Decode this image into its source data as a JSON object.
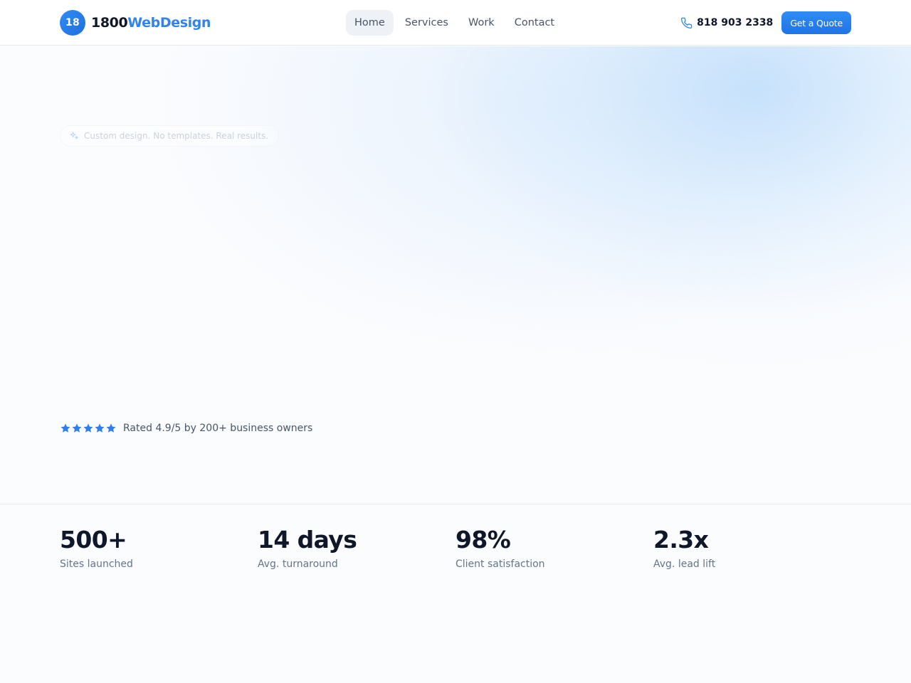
{
  "header": {
    "logo_badge": "18",
    "logo_text_a": "1800",
    "logo_text_b": "WebDesign",
    "nav": [
      {
        "label": "Home",
        "active": true
      },
      {
        "label": "Services",
        "active": false
      },
      {
        "label": "Work",
        "active": false
      },
      {
        "label": "Contact",
        "active": false
      }
    ],
    "phone": "818 903 2338",
    "phone_icon": "phone-icon",
    "cta_label": "Get a Quote"
  },
  "hero": {
    "pill_icon": "sparkle-icon",
    "pill_text": "Custom design. No templates. Real results.",
    "rating_stars": 5,
    "rating_text": "Rated 4.9/5 by 200+ business owners"
  },
  "stats": [
    {
      "value": "500+",
      "label": "Sites launched"
    },
    {
      "value": "14 days",
      "label": "Avg. turnaround"
    },
    {
      "value": "98%",
      "label": "Client satisfaction"
    },
    {
      "value": "2.3x",
      "label": "Avg. lead lift"
    }
  ],
  "colors": {
    "accent": "#2f84ee",
    "text": "#0f172a",
    "muted": "#64748b",
    "background": "#fbfcfe"
  }
}
